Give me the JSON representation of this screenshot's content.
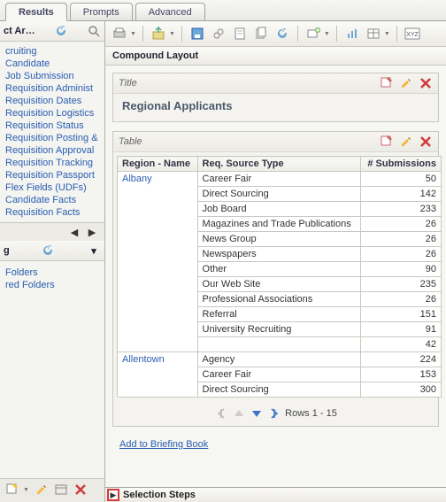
{
  "tabs": {
    "results": "Results",
    "prompts": "Prompts",
    "advanced": "Advanced"
  },
  "left": {
    "subjectAreasTitle": "ct Ar…",
    "links": [
      "cruiting",
      "Candidate",
      "Job Submission",
      "Requisition Administ",
      "Requisition Dates",
      "Requisition Logistics",
      "Requisition Status",
      "Requisition Posting &",
      "Requisition Approval",
      "Requisition Tracking",
      "Requisition Passport",
      "Flex Fields (UDFs)",
      "Candidate Facts",
      "Requisition Facts"
    ],
    "catalogTitle": "g",
    "folders": [
      "Folders",
      "red Folders"
    ]
  },
  "toolbar": {
    "icons": [
      "print",
      "export",
      "save",
      "cycle",
      "page",
      "grid",
      "copy",
      "refresh",
      "new-view",
      "insert-graph",
      "insert-table",
      "properties"
    ]
  },
  "compound": {
    "label": "Compound Layout",
    "titleSection": {
      "header": "Title",
      "value": "Regional Applicants"
    },
    "tableSection": {
      "header": "Table",
      "columns": [
        "Region - Name",
        "Req. Source Type",
        "# Submissions"
      ]
    }
  },
  "chart_data": {
    "type": "table",
    "columns": [
      "Region - Name",
      "Req. Source Type",
      "# Submissions"
    ],
    "rows": [
      {
        "region": "Albany",
        "source": "Career Fair",
        "submissions": 50
      },
      {
        "region": "Albany",
        "source": "Direct Sourcing",
        "submissions": 142
      },
      {
        "region": "Albany",
        "source": "Job Board",
        "submissions": 233
      },
      {
        "region": "Albany",
        "source": "Magazines and Trade Publications",
        "submissions": 26
      },
      {
        "region": "Albany",
        "source": "News Group",
        "submissions": 26
      },
      {
        "region": "Albany",
        "source": "Newspapers",
        "submissions": 26
      },
      {
        "region": "Albany",
        "source": "Other",
        "submissions": 90
      },
      {
        "region": "Albany",
        "source": "Our Web Site",
        "submissions": 235
      },
      {
        "region": "Albany",
        "source": "Professional Associations",
        "submissions": 26
      },
      {
        "region": "Albany",
        "source": "Referral",
        "submissions": 151
      },
      {
        "region": "Albany",
        "source": "University Recruiting",
        "submissions": 91
      },
      {
        "region": "Albany",
        "source": "",
        "submissions": 42
      },
      {
        "region": "Allentown",
        "source": "Agency",
        "submissions": 224
      },
      {
        "region": "Allentown",
        "source": "Career Fair",
        "submissions": 153
      },
      {
        "region": "Allentown",
        "source": "Direct Sourcing",
        "submissions": 300
      }
    ]
  },
  "pager": {
    "label": "Rows 1 - 15"
  },
  "footer": {
    "briefingBook": "Add to Briefing Book",
    "selectionSteps": "Selection Steps"
  },
  "colors": {
    "link": "#2a5db0",
    "headerText": "#4a5a6a",
    "highlightBox": "#d23a3a"
  }
}
